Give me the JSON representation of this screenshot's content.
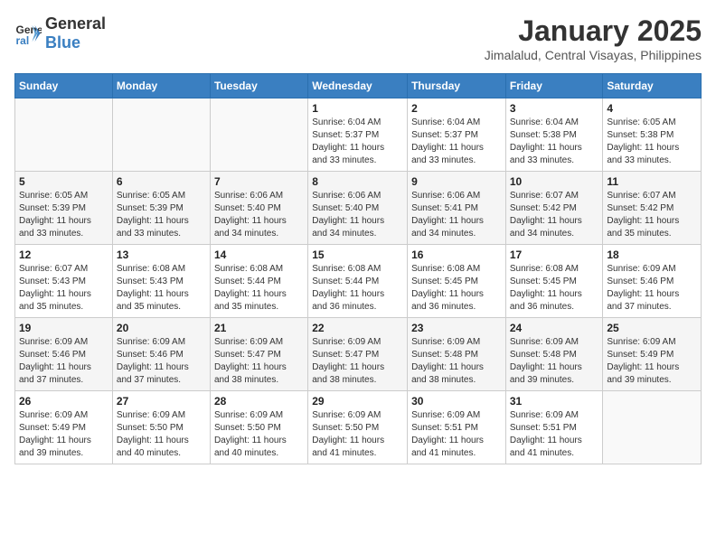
{
  "logo": {
    "general": "General",
    "blue": "Blue"
  },
  "header": {
    "month": "January 2025",
    "location": "Jimalalud, Central Visayas, Philippines"
  },
  "weekdays": [
    "Sunday",
    "Monday",
    "Tuesday",
    "Wednesday",
    "Thursday",
    "Friday",
    "Saturday"
  ],
  "weeks": [
    [
      {
        "day": "",
        "info": ""
      },
      {
        "day": "",
        "info": ""
      },
      {
        "day": "",
        "info": ""
      },
      {
        "day": "1",
        "info": "Sunrise: 6:04 AM\nSunset: 5:37 PM\nDaylight: 11 hours\nand 33 minutes."
      },
      {
        "day": "2",
        "info": "Sunrise: 6:04 AM\nSunset: 5:37 PM\nDaylight: 11 hours\nand 33 minutes."
      },
      {
        "day": "3",
        "info": "Sunrise: 6:04 AM\nSunset: 5:38 PM\nDaylight: 11 hours\nand 33 minutes."
      },
      {
        "day": "4",
        "info": "Sunrise: 6:05 AM\nSunset: 5:38 PM\nDaylight: 11 hours\nand 33 minutes."
      }
    ],
    [
      {
        "day": "5",
        "info": "Sunrise: 6:05 AM\nSunset: 5:39 PM\nDaylight: 11 hours\nand 33 minutes."
      },
      {
        "day": "6",
        "info": "Sunrise: 6:05 AM\nSunset: 5:39 PM\nDaylight: 11 hours\nand 33 minutes."
      },
      {
        "day": "7",
        "info": "Sunrise: 6:06 AM\nSunset: 5:40 PM\nDaylight: 11 hours\nand 34 minutes."
      },
      {
        "day": "8",
        "info": "Sunrise: 6:06 AM\nSunset: 5:40 PM\nDaylight: 11 hours\nand 34 minutes."
      },
      {
        "day": "9",
        "info": "Sunrise: 6:06 AM\nSunset: 5:41 PM\nDaylight: 11 hours\nand 34 minutes."
      },
      {
        "day": "10",
        "info": "Sunrise: 6:07 AM\nSunset: 5:42 PM\nDaylight: 11 hours\nand 34 minutes."
      },
      {
        "day": "11",
        "info": "Sunrise: 6:07 AM\nSunset: 5:42 PM\nDaylight: 11 hours\nand 35 minutes."
      }
    ],
    [
      {
        "day": "12",
        "info": "Sunrise: 6:07 AM\nSunset: 5:43 PM\nDaylight: 11 hours\nand 35 minutes."
      },
      {
        "day": "13",
        "info": "Sunrise: 6:08 AM\nSunset: 5:43 PM\nDaylight: 11 hours\nand 35 minutes."
      },
      {
        "day": "14",
        "info": "Sunrise: 6:08 AM\nSunset: 5:44 PM\nDaylight: 11 hours\nand 35 minutes."
      },
      {
        "day": "15",
        "info": "Sunrise: 6:08 AM\nSunset: 5:44 PM\nDaylight: 11 hours\nand 36 minutes."
      },
      {
        "day": "16",
        "info": "Sunrise: 6:08 AM\nSunset: 5:45 PM\nDaylight: 11 hours\nand 36 minutes."
      },
      {
        "day": "17",
        "info": "Sunrise: 6:08 AM\nSunset: 5:45 PM\nDaylight: 11 hours\nand 36 minutes."
      },
      {
        "day": "18",
        "info": "Sunrise: 6:09 AM\nSunset: 5:46 PM\nDaylight: 11 hours\nand 37 minutes."
      }
    ],
    [
      {
        "day": "19",
        "info": "Sunrise: 6:09 AM\nSunset: 5:46 PM\nDaylight: 11 hours\nand 37 minutes."
      },
      {
        "day": "20",
        "info": "Sunrise: 6:09 AM\nSunset: 5:46 PM\nDaylight: 11 hours\nand 37 minutes."
      },
      {
        "day": "21",
        "info": "Sunrise: 6:09 AM\nSunset: 5:47 PM\nDaylight: 11 hours\nand 38 minutes."
      },
      {
        "day": "22",
        "info": "Sunrise: 6:09 AM\nSunset: 5:47 PM\nDaylight: 11 hours\nand 38 minutes."
      },
      {
        "day": "23",
        "info": "Sunrise: 6:09 AM\nSunset: 5:48 PM\nDaylight: 11 hours\nand 38 minutes."
      },
      {
        "day": "24",
        "info": "Sunrise: 6:09 AM\nSunset: 5:48 PM\nDaylight: 11 hours\nand 39 minutes."
      },
      {
        "day": "25",
        "info": "Sunrise: 6:09 AM\nSunset: 5:49 PM\nDaylight: 11 hours\nand 39 minutes."
      }
    ],
    [
      {
        "day": "26",
        "info": "Sunrise: 6:09 AM\nSunset: 5:49 PM\nDaylight: 11 hours\nand 39 minutes."
      },
      {
        "day": "27",
        "info": "Sunrise: 6:09 AM\nSunset: 5:50 PM\nDaylight: 11 hours\nand 40 minutes."
      },
      {
        "day": "28",
        "info": "Sunrise: 6:09 AM\nSunset: 5:50 PM\nDaylight: 11 hours\nand 40 minutes."
      },
      {
        "day": "29",
        "info": "Sunrise: 6:09 AM\nSunset: 5:50 PM\nDaylight: 11 hours\nand 41 minutes."
      },
      {
        "day": "30",
        "info": "Sunrise: 6:09 AM\nSunset: 5:51 PM\nDaylight: 11 hours\nand 41 minutes."
      },
      {
        "day": "31",
        "info": "Sunrise: 6:09 AM\nSunset: 5:51 PM\nDaylight: 11 hours\nand 41 minutes."
      },
      {
        "day": "",
        "info": ""
      }
    ]
  ]
}
